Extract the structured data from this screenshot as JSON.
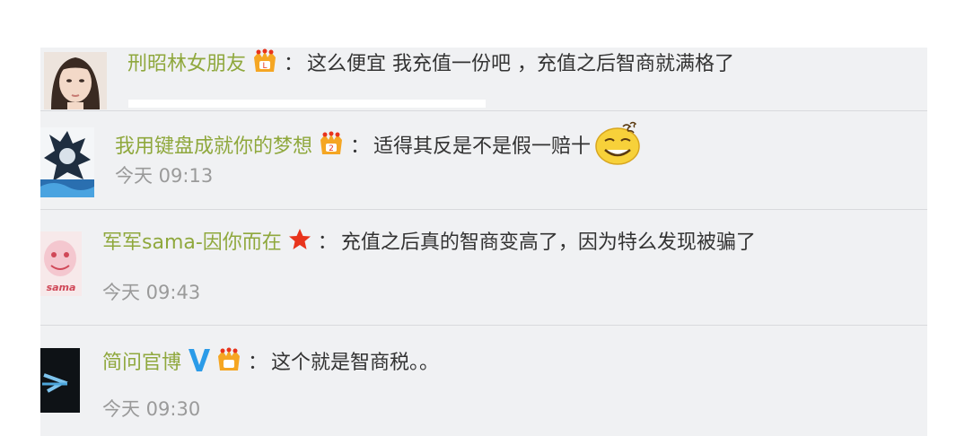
{
  "comments": [
    {
      "username": "刑昭林女朋友",
      "badge": "crown-badge-icon",
      "colon": "：",
      "text": "这么便宜  我充值一份吧    ，充值之后智商就满格了"
    },
    {
      "username": "我用键盘成就你的梦想",
      "badge": "crown-badge-icon",
      "colon": "：",
      "text": "适得其反是不是假一赔十",
      "emoji": "dizzy-smile-emoji-icon",
      "time": "今天 09:13"
    },
    {
      "username": "军军sama-因你而在",
      "badge": "red-star-icon",
      "colon": "：",
      "text": "充值之后真的智商变高了，因为特么发现被骗了",
      "time": "今天 09:43",
      "avatar_text": "sama"
    },
    {
      "username": "简问官博",
      "badge": "verified-v-icon",
      "colon": "：",
      "text": "这个就是智商税。。",
      "time": "今天 09:30"
    }
  ],
  "colors": {
    "username": "#8fa83d",
    "text": "#333333",
    "time": "#9a9a9a",
    "panel_bg": "#f0f1f3",
    "verified_blue": "#2b9be8",
    "badge_orange": "#f5a623",
    "star_red": "#e8341c"
  }
}
